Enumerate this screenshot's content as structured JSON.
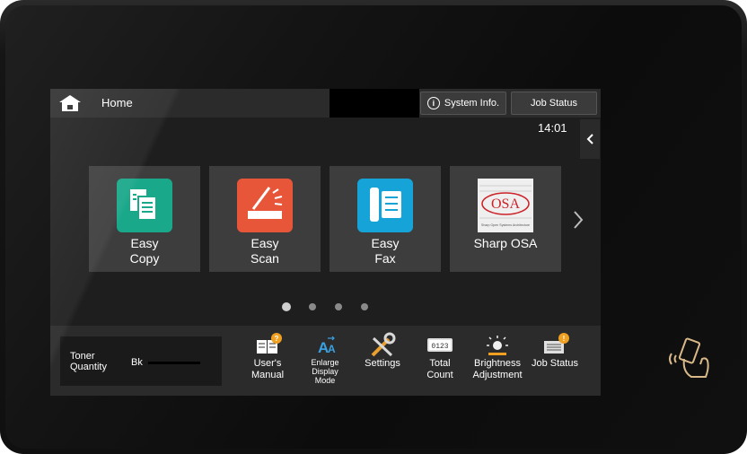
{
  "header": {
    "home_label": "Home",
    "system_info_label": "System Info.",
    "job_status_label": "Job Status",
    "clock": "14:01"
  },
  "tiles": [
    {
      "line1": "Easy",
      "line2": "Copy",
      "icon": "easy-copy-icon",
      "color": "#1aa88a"
    },
    {
      "line1": "Easy",
      "line2": "Scan",
      "icon": "easy-scan-icon",
      "color": "#e8563a"
    },
    {
      "line1": "Easy",
      "line2": "Fax",
      "icon": "easy-fax-icon",
      "color": "#16a3d8"
    },
    {
      "line1": "Sharp OSA",
      "line2": "",
      "icon": "sharp-osa-icon",
      "color": "#cc2229"
    }
  ],
  "pager": {
    "pages": 4,
    "active": 1
  },
  "toner": {
    "label_line1": "Toner",
    "label_line2": "Quantity",
    "bk_label": "Bk"
  },
  "tools": [
    {
      "lines": [
        "User's",
        "Manual"
      ],
      "icon": "users-manual-icon"
    },
    {
      "lines": [
        "Enlarge",
        "Display",
        "Mode"
      ],
      "icon": "enlarge-display-icon"
    },
    {
      "lines": [
        "Settings"
      ],
      "icon": "settings-icon"
    },
    {
      "lines": [
        "Total",
        "Count"
      ],
      "icon": "total-count-icon",
      "counter": "0123"
    },
    {
      "lines": [
        "Brightness",
        "Adjustment"
      ],
      "icon": "brightness-icon"
    },
    {
      "lines": [
        "Job Status"
      ],
      "icon": "job-status-icon"
    }
  ],
  "osa_logo_text": "OSA",
  "osa_logo_caption": "Sharp Open Systems Architecture"
}
